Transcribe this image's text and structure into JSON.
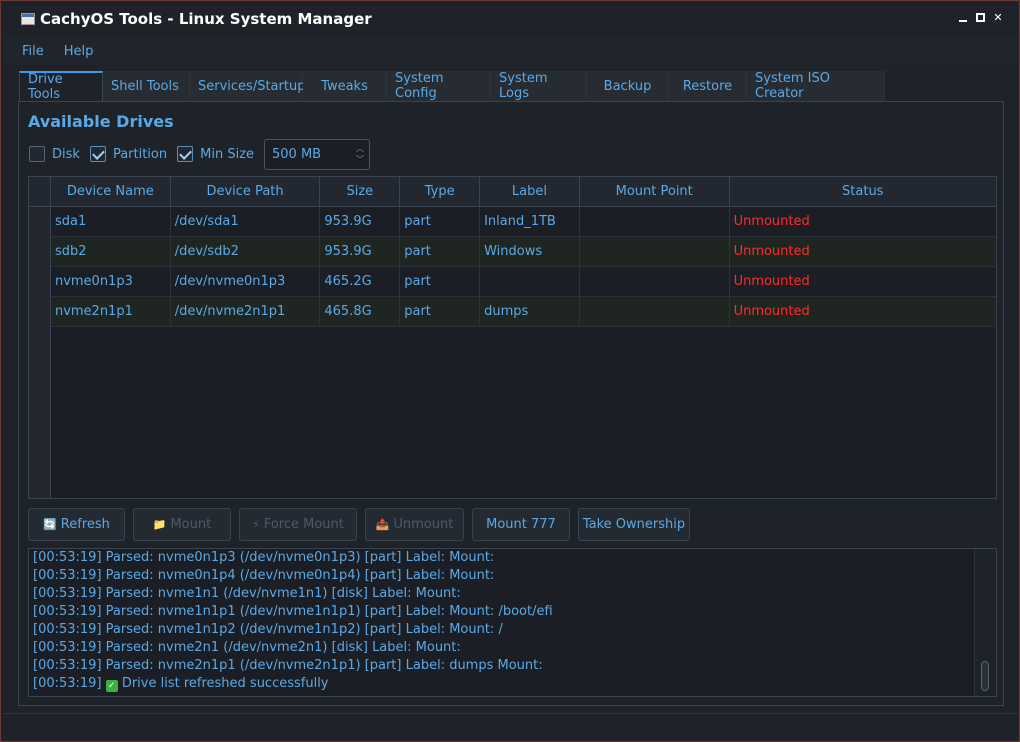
{
  "window": {
    "title": "CachyOS Tools - Linux System Manager"
  },
  "menubar": {
    "items": [
      "File",
      "Help"
    ]
  },
  "tabs": [
    {
      "label": "Drive Tools",
      "active": true
    },
    {
      "label": "Shell Tools"
    },
    {
      "label": "Services/Startup"
    },
    {
      "label": "Tweaks"
    },
    {
      "label": "System Config"
    },
    {
      "label": "System Logs"
    },
    {
      "label": "Backup"
    },
    {
      "label": "Restore"
    },
    {
      "label": "System ISO Creator"
    }
  ],
  "drives": {
    "title": "Available Drives",
    "filters": {
      "disk": {
        "label": "Disk",
        "checked": false
      },
      "partition": {
        "label": "Partition",
        "checked": true
      },
      "min_size": {
        "label": "Min Size",
        "checked": true
      },
      "min_size_value": "500 MB"
    },
    "columns": [
      "Device Name",
      "Device Path",
      "Size",
      "Type",
      "Label",
      "Mount Point",
      "Status"
    ],
    "rows": [
      {
        "num": "1",
        "name": "sda1",
        "path": "/dev/sda1",
        "size": "953.9G",
        "type": "part",
        "label": "Inland_1TB",
        "mount": "",
        "status": "Unmounted"
      },
      {
        "num": "2",
        "name": "sdb2",
        "path": "/dev/sdb2",
        "size": "953.9G",
        "type": "part",
        "label": "Windows",
        "mount": "",
        "status": "Unmounted"
      },
      {
        "num": "3",
        "name": "nvme0n1p3",
        "path": "/dev/nvme0n1p3",
        "size": "465.2G",
        "type": "part",
        "label": "",
        "mount": "",
        "status": "Unmounted"
      },
      {
        "num": "4",
        "name": "nvme2n1p1",
        "path": "/dev/nvme2n1p1",
        "size": "465.8G",
        "type": "part",
        "label": "dumps",
        "mount": "",
        "status": "Unmounted"
      }
    ],
    "status_color": "#ff2a2a"
  },
  "buttons": {
    "refresh": {
      "icon": "🔄",
      "label": "Refresh"
    },
    "mount": {
      "icon": "📁",
      "label": "Mount"
    },
    "force_mount": {
      "icon": "⚡",
      "label": "Force Mount"
    },
    "unmount": {
      "icon": "📤",
      "label": "Unmount"
    },
    "mount777": {
      "label": "Mount 777"
    },
    "take_ownership": {
      "label": "Take Ownership"
    }
  },
  "log": [
    "[00:53:19] Parsed: nvme0n1p3 (/dev/nvme0n1p3) [part] Label:  Mount:",
    "[00:53:19] Parsed: nvme0n1p4 (/dev/nvme0n1p4) [part] Label:  Mount:",
    "[00:53:19] Parsed: nvme1n1 (/dev/nvme1n1) [disk] Label:  Mount:",
    "[00:53:19] Parsed: nvme1n1p1 (/dev/nvme1n1p1) [part] Label:  Mount: /boot/efi",
    "[00:53:19] Parsed: nvme1n1p2 (/dev/nvme1n1p2) [part] Label:  Mount: /",
    "[00:53:19] Parsed: nvme2n1 (/dev/nvme2n1) [disk] Label:  Mount:",
    "[00:53:19] Parsed: nvme2n1p1 (/dev/nvme2n1p1) [part] Label: dumps Mount:"
  ],
  "log_last": {
    "time": "[00:53:19]",
    "text": "Drive list refreshed successfully"
  },
  "colors": {
    "accent": "#5aa9e6",
    "active_tab": "#3d9be9"
  }
}
